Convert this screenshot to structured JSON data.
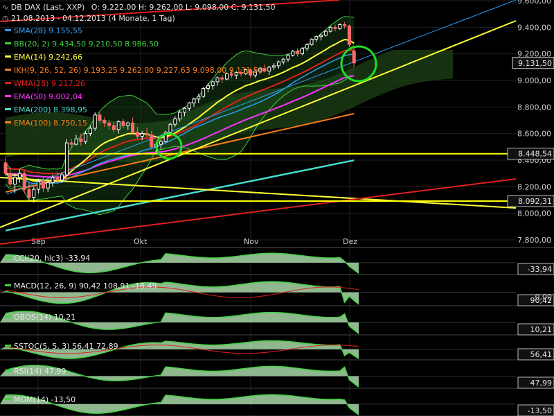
{
  "header": {
    "title": "DB DAX (Last, XXP)",
    "ohlc": "O: 9.222,00  H: 9.262,00  L: 9.098,00  C: 9.131,50",
    "range": "21.08.2013 - 04.12.2013 (4 Monate, 1 Tag)"
  },
  "colors": {
    "background": "#000000",
    "candle_up": "#ffffff",
    "candle_down": "#ff6a6a",
    "sma": "#2a9df4",
    "bb": "#3fd33f",
    "ema14": "#ffff33",
    "ikh": "#d8d800",
    "wma": "#e0201e",
    "ema50": "#ff33ff",
    "ema200": "#44ddcc",
    "ema100": "#ff7f1a",
    "highlight_circle": "#22dd22",
    "hline": "#ffff00"
  },
  "legend": [
    {
      "text": "SMA(28)  9.155,55",
      "color": "#2a9df4"
    },
    {
      "text": "BB(20, 2)  9.434,50  9.210,50  8.986,50",
      "color": "#3fd33f"
    },
    {
      "text": "EMA(14)  9.242,66",
      "color": "#ffff33"
    },
    {
      "text": "IKH(9, 26, 52, 26)  9.193,25  9.262,00  9.227,63  9.098,00  9.131,50",
      "color": "#ff7f1a"
    },
    {
      "text": "WMA(28)  9.217,26",
      "color": "#e0201e"
    },
    {
      "text": "EMA(50)  9.002,04",
      "color": "#ff33ff"
    },
    {
      "text": "EMA(200)  8.398,95",
      "color": "#44ddcc"
    },
    {
      "text": "EMA(100)  8.750,15",
      "color": "#ff7f1a"
    }
  ],
  "chart_data": {
    "type": "candlestick",
    "title": "DB DAX (Last, XXP)",
    "x_labels": [
      "Sep",
      "Okt",
      "Nov",
      "Dez"
    ],
    "y_ticks": [
      "9.600,00",
      "9.400,00",
      "9.200,00",
      "9.000,00",
      "8.800,00",
      "8.600,00",
      "8.400,00",
      "8.200,00",
      "8.000,00",
      "7.800,00"
    ],
    "ylim": [
      7700,
      9600
    ],
    "last_price": "9.131,50",
    "horizontal_lines": [
      {
        "value": 8448.54,
        "label": "8.448,54"
      },
      {
        "value": 8092.31,
        "label": "8.092,31"
      }
    ],
    "ohlc": [
      [
        8380,
        8420,
        8280,
        8300
      ],
      [
        8300,
        8340,
        8200,
        8220
      ],
      [
        8220,
        8300,
        8150,
        8270
      ],
      [
        8270,
        8330,
        8230,
        8300
      ],
      [
        8300,
        8320,
        8150,
        8180
      ],
      [
        8180,
        8230,
        8100,
        8120
      ],
      [
        8120,
        8200,
        8080,
        8180
      ],
      [
        8180,
        8260,
        8150,
        8240
      ],
      [
        8240,
        8280,
        8160,
        8190
      ],
      [
        8190,
        8250,
        8160,
        8230
      ],
      [
        8230,
        8290,
        8200,
        8270
      ],
      [
        8270,
        8310,
        8220,
        8250
      ],
      [
        8250,
        8310,
        8230,
        8290
      ],
      [
        8290,
        8560,
        8280,
        8530
      ],
      [
        8530,
        8560,
        8490,
        8520
      ],
      [
        8520,
        8590,
        8510,
        8560
      ],
      [
        8560,
        8600,
        8510,
        8540
      ],
      [
        8540,
        8620,
        8520,
        8600
      ],
      [
        8600,
        8660,
        8580,
        8640
      ],
      [
        8640,
        8760,
        8620,
        8740
      ],
      [
        8740,
        8760,
        8680,
        8700
      ],
      [
        8700,
        8720,
        8650,
        8680
      ],
      [
        8680,
        8700,
        8630,
        8660
      ],
      [
        8660,
        8690,
        8610,
        8630
      ],
      [
        8630,
        8700,
        8600,
        8690
      ],
      [
        8690,
        8710,
        8640,
        8660
      ],
      [
        8660,
        8690,
        8630,
        8680
      ],
      [
        8680,
        8720,
        8590,
        8610
      ],
      [
        8610,
        8650,
        8560,
        8580
      ],
      [
        8580,
        8620,
        8550,
        8600
      ],
      [
        8600,
        8640,
        8570,
        8590
      ],
      [
        8590,
        8620,
        8480,
        8500
      ],
      [
        8500,
        8540,
        8460,
        8520
      ],
      [
        8520,
        8560,
        8480,
        8540
      ],
      [
        8540,
        8620,
        8530,
        8610
      ],
      [
        8610,
        8680,
        8600,
        8670
      ],
      [
        8670,
        8730,
        8650,
        8710
      ],
      [
        8710,
        8780,
        8690,
        8760
      ],
      [
        8760,
        8800,
        8730,
        8790
      ],
      [
        8790,
        8840,
        8770,
        8830
      ],
      [
        8830,
        8870,
        8800,
        8860
      ],
      [
        8860,
        8900,
        8830,
        8880
      ],
      [
        8880,
        8950,
        8870,
        8940
      ],
      [
        8940,
        8980,
        8910,
        8960
      ],
      [
        8960,
        9000,
        8930,
        8990
      ],
      [
        8990,
        9030,
        8960,
        9020
      ],
      [
        9020,
        9040,
        8980,
        9010
      ],
      [
        9010,
        9060,
        9000,
        9050
      ],
      [
        9050,
        9080,
        9020,
        9040
      ],
      [
        9040,
        9070,
        9010,
        9060
      ],
      [
        9060,
        9080,
        9030,
        9050
      ],
      [
        9050,
        9090,
        9040,
        9080
      ],
      [
        9080,
        9090,
        9020,
        9040
      ],
      [
        9040,
        9080,
        9020,
        9070
      ],
      [
        9070,
        9100,
        9050,
        9090
      ],
      [
        9090,
        9120,
        9060,
        9070
      ],
      [
        9070,
        9110,
        9040,
        9100
      ],
      [
        9100,
        9130,
        9080,
        9110
      ],
      [
        9110,
        9150,
        9090,
        9140
      ],
      [
        9140,
        9170,
        9120,
        9160
      ],
      [
        9160,
        9200,
        9140,
        9190
      ],
      [
        9190,
        9230,
        9180,
        9220
      ],
      [
        9220,
        9240,
        9180,
        9200
      ],
      [
        9200,
        9250,
        9190,
        9240
      ],
      [
        9240,
        9280,
        9220,
        9270
      ],
      [
        9270,
        9320,
        9260,
        9310
      ],
      [
        9310,
        9340,
        9290,
        9330
      ],
      [
        9330,
        9360,
        9300,
        9340
      ],
      [
        9340,
        9380,
        9330,
        9370
      ],
      [
        9370,
        9410,
        9360,
        9400
      ],
      [
        9400,
        9420,
        9370,
        9390
      ],
      [
        9390,
        9430,
        9380,
        9420
      ],
      [
        9420,
        9440,
        9390,
        9410
      ],
      [
        9410,
        9420,
        9250,
        9270
      ],
      [
        9222,
        9262,
        9098,
        9131.5
      ]
    ],
    "indicators": {
      "ema200": {
        "x": [
          0,
          74
        ],
        "y": [
          7870,
          8398.95
        ]
      },
      "ema100": {
        "x": [
          0,
          74
        ],
        "y": [
          8160,
          8750.15
        ]
      },
      "upper_trend": {
        "x": [
          0,
          115
        ],
        "y": [
          8450,
          9460
        ]
      },
      "lower_trend": {
        "x": [
          0,
          115
        ],
        "y": [
          7880,
          8450
        ]
      },
      "red_trend_top": {
        "x": [
          0,
          70
        ],
        "y": [
          9480,
          9610
        ]
      }
    },
    "panels": [
      {
        "id": "cci",
        "label": "CCI(20, hlc3)  -33,94",
        "value": "-33,94"
      },
      {
        "id": "macd",
        "label": "MACD(12, 26, 9)  90,42  108,91  -18,49",
        "value": "90,42",
        "extra": "0,00"
      },
      {
        "id": "obos",
        "label": "OBOS(14)  10,21",
        "value": "10,21"
      },
      {
        "id": "sstoc",
        "label": "SSTOC(5, 5, 3)  56,41  72,89",
        "value": "56,41"
      },
      {
        "id": "rsi",
        "label": "RSI(14)  47,99",
        "value": "47,99"
      },
      {
        "id": "mom",
        "label": "MOM(14)  -13,50",
        "value": "-13,50"
      }
    ]
  }
}
